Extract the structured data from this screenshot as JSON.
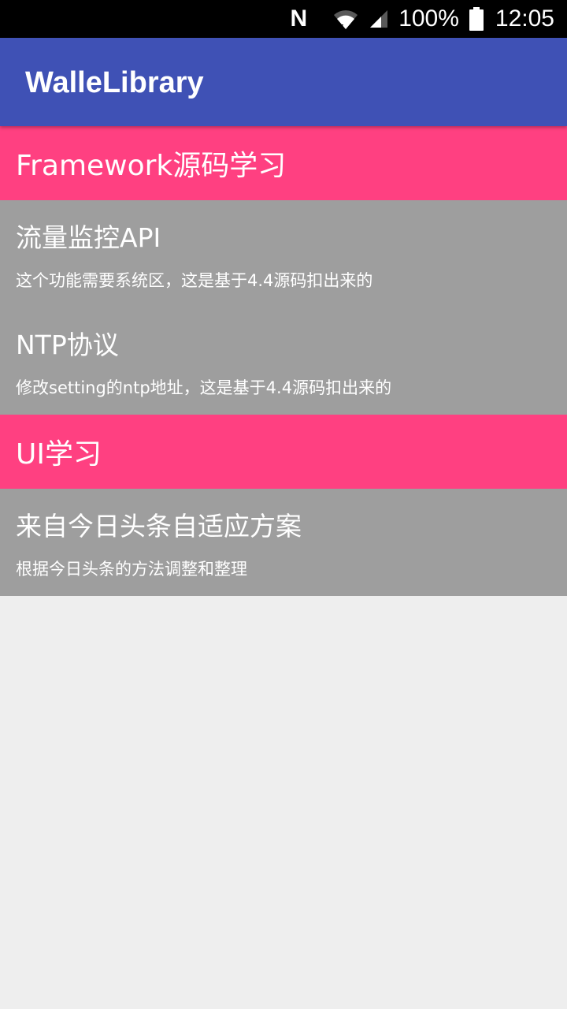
{
  "status_bar": {
    "nfc_label": "N",
    "battery": "100%",
    "time": "12:05",
    "icons": [
      "nfc-icon",
      "wifi-icon",
      "signal-icon",
      "battery-icon"
    ]
  },
  "app_bar": {
    "title": "WalleLibrary"
  },
  "sections": [
    {
      "header": "Framework源码学习",
      "items": [
        {
          "title": "流量监控API",
          "desc": "这个功能需要系统区，这是基于4.4源码扣出来的"
        },
        {
          "title": "NTP协议",
          "desc": "修改setting的ntp地址，这是基于4.4源码扣出来的"
        }
      ]
    },
    {
      "header": "UI学习",
      "items": [
        {
          "title": "来自今日头条自适应方案",
          "desc": "根据今日头条的方法调整和整理"
        }
      ]
    }
  ],
  "colors": {
    "app_bar": "#3f51b5",
    "section_header": "#ff4081",
    "item_background": "#9e9e9e",
    "page_background": "#eeeeee"
  }
}
